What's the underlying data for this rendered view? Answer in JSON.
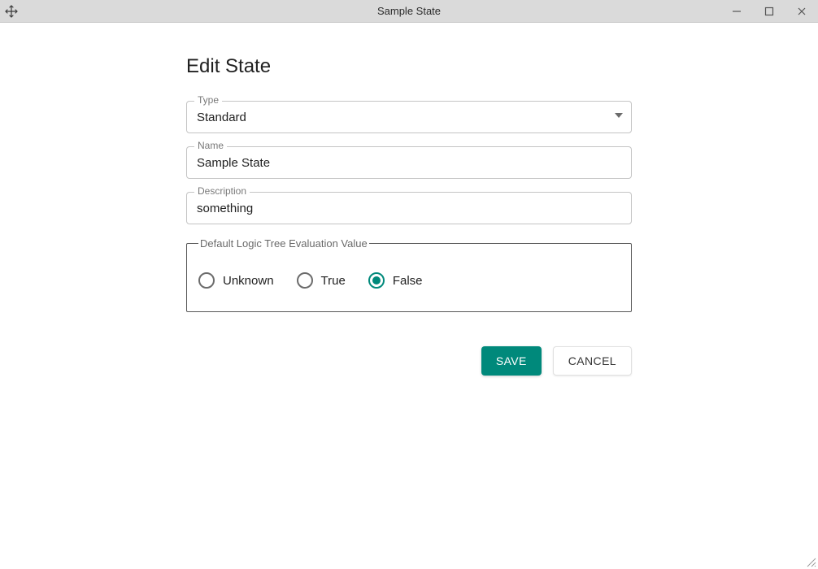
{
  "window": {
    "title": "Sample State"
  },
  "page": {
    "title": "Edit State"
  },
  "fields": {
    "type": {
      "label": "Type",
      "value": "Standard"
    },
    "name": {
      "label": "Name",
      "value": "Sample State"
    },
    "description": {
      "label": "Description",
      "value": "something"
    }
  },
  "group": {
    "legend": "Default Logic Tree Evaluation Value",
    "options": {
      "unknown": "Unknown",
      "true": "True",
      "false": "False"
    },
    "selected": "false"
  },
  "actions": {
    "save": "SAVE",
    "cancel": "CANCEL"
  },
  "colors": {
    "accent": "#00897b"
  }
}
